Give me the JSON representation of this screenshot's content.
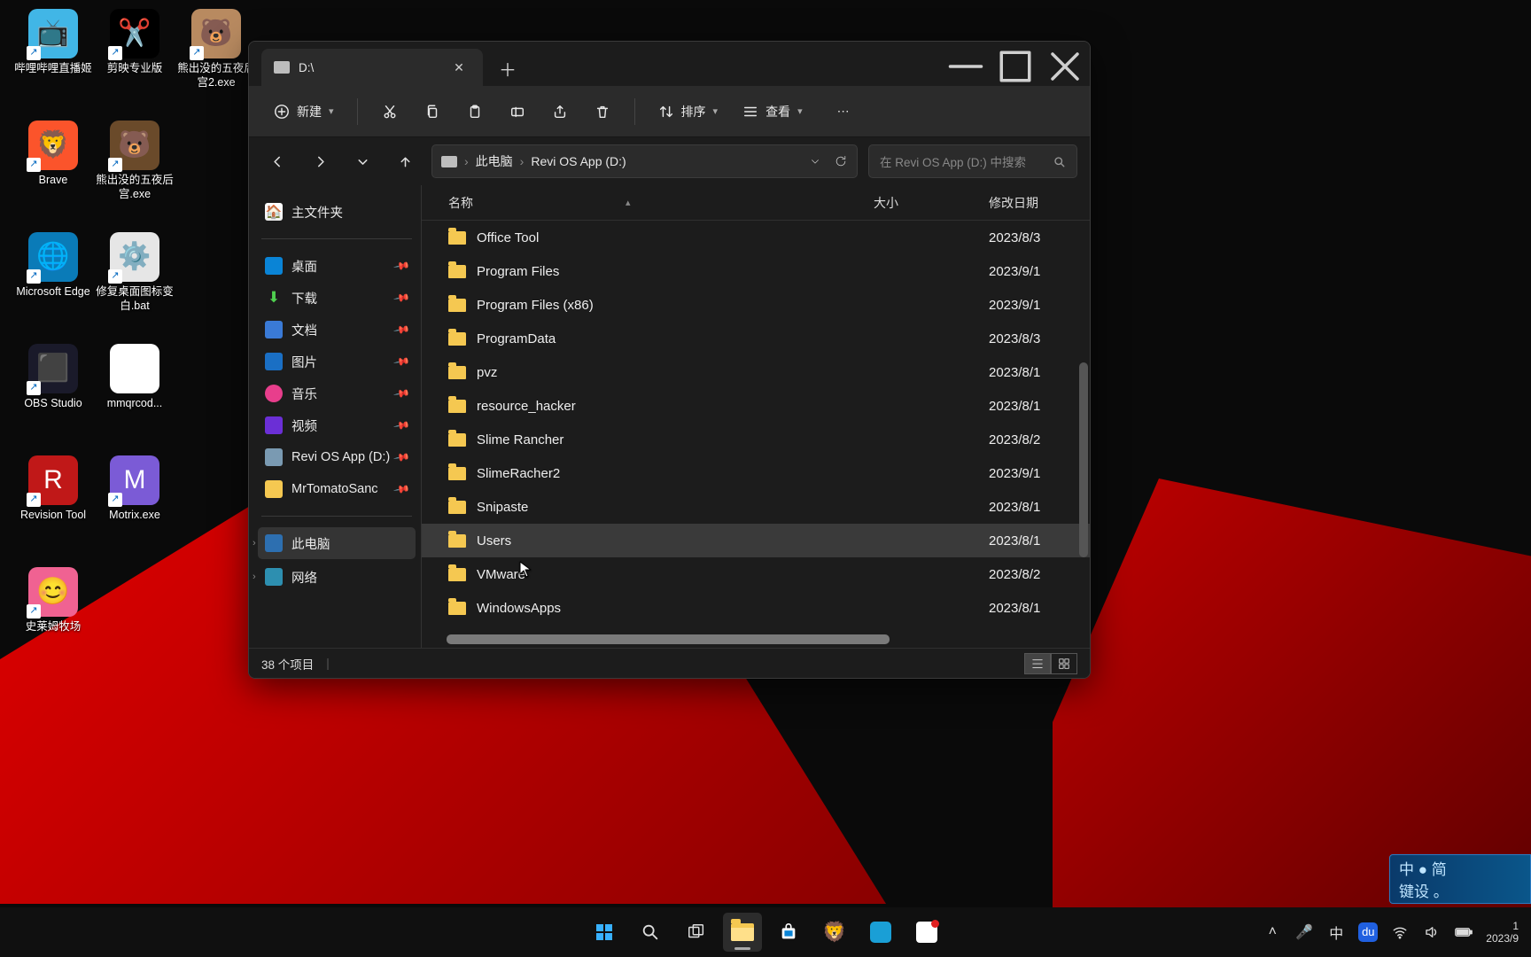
{
  "desktop_icons": [
    {
      "label": "哔哩哔哩直播姬",
      "bg": "#41b6e6",
      "glyph": "📺",
      "shortcut": true
    },
    {
      "label": "剪映专业版",
      "bg": "#000",
      "glyph": "✂️",
      "shortcut": true
    },
    {
      "label": "熊出没的五夜后宫2.exe",
      "bg": "#b88a60",
      "glyph": "🐻",
      "shortcut": true
    },
    {
      "label": "Brave",
      "bg": "#fb542b",
      "glyph": "🦁",
      "shortcut": true
    },
    {
      "label": "熊出没的五夜后宫.exe",
      "bg": "#6a4a2a",
      "glyph": "🐻",
      "shortcut": true
    },
    {
      "label": "",
      "bg": "transparent",
      "glyph": "",
      "shortcut": false
    },
    {
      "label": "Microsoft Edge",
      "bg": "#0a7bb8",
      "glyph": "🌐",
      "shortcut": true
    },
    {
      "label": "修复桌面图标变白.bat",
      "bg": "#e6e6e6",
      "glyph": "⚙️",
      "shortcut": true
    },
    {
      "label": "",
      "bg": "transparent",
      "glyph": "",
      "shortcut": false
    },
    {
      "label": "OBS Studio",
      "bg": "#1a1a2a",
      "glyph": "⬛",
      "shortcut": true
    },
    {
      "label": "mmqrcod...",
      "bg": "#fff",
      "glyph": "▦",
      "shortcut": false
    },
    {
      "label": "",
      "bg": "transparent",
      "glyph": "",
      "shortcut": false
    },
    {
      "label": "Revision Tool",
      "bg": "#c01818",
      "glyph": "R",
      "shortcut": true
    },
    {
      "label": "Motrix.exe",
      "bg": "#7b5bd6",
      "glyph": "M",
      "shortcut": true
    },
    {
      "label": "",
      "bg": "transparent",
      "glyph": "",
      "shortcut": false
    },
    {
      "label": "史莱姆牧场",
      "bg": "#f06292",
      "glyph": "😊",
      "shortcut": true
    }
  ],
  "explorer": {
    "tab_title": "D:\\",
    "toolbar": {
      "new": "新建",
      "sort": "排序",
      "view": "查看"
    },
    "breadcrumb": {
      "pc": "此电脑",
      "drive": "Revi OS App (D:)"
    },
    "search_placeholder": "在 Revi OS App (D:) 中搜索",
    "columns": {
      "name": "名称",
      "size": "大小",
      "date": "修改日期"
    },
    "sidebar": {
      "home": "主文件夹",
      "pinned": [
        {
          "label": "桌面",
          "icon": "i-desk",
          "pin": true
        },
        {
          "label": "下载",
          "icon": "i-dl",
          "pin": true,
          "glyph": "⬇"
        },
        {
          "label": "文档",
          "icon": "i-doc",
          "pin": true
        },
        {
          "label": "图片",
          "icon": "i-pic",
          "pin": true
        },
        {
          "label": "音乐",
          "icon": "i-mus",
          "pin": true
        },
        {
          "label": "视频",
          "icon": "i-vid",
          "pin": true
        },
        {
          "label": "Revi OS App (D:)",
          "icon": "i-drv",
          "pin": true
        },
        {
          "label": "MrTomatoSanc",
          "icon": "i-fld",
          "pin": true
        }
      ],
      "this_pc": "此电脑",
      "network": "网络"
    },
    "rows": [
      {
        "name": "Office Tool",
        "date": "2023/8/3"
      },
      {
        "name": "Program Files",
        "date": "2023/9/1"
      },
      {
        "name": "Program Files (x86)",
        "date": "2023/9/1"
      },
      {
        "name": "ProgramData",
        "date": "2023/8/3"
      },
      {
        "name": "pvz",
        "date": "2023/8/1"
      },
      {
        "name": "resource_hacker",
        "date": "2023/8/1"
      },
      {
        "name": "Slime Rancher",
        "date": "2023/8/2"
      },
      {
        "name": "SlimeRacher2",
        "date": "2023/9/1"
      },
      {
        "name": "Snipaste",
        "date": "2023/8/1"
      },
      {
        "name": "Users",
        "date": "2023/8/1",
        "hl": true
      },
      {
        "name": "VMware",
        "date": "2023/8/2"
      },
      {
        "name": "WindowsApps",
        "date": "2023/8/1"
      }
    ],
    "status": "38 个项目"
  },
  "watermark": {
    "l1": "中 ● 简",
    "l2": "键设 。"
  },
  "tray": {
    "ime": "中",
    "time": "1",
    "date": "2023/9"
  }
}
